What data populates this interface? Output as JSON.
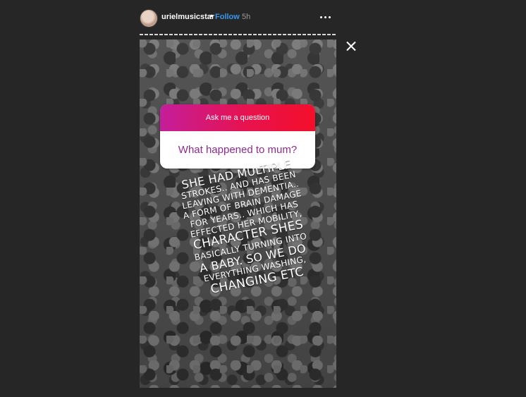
{
  "header": {
    "username": "urielmusicstar",
    "separator": "•",
    "follow_label": "Follow",
    "time": "5h"
  },
  "story": {
    "progress_segments": 1,
    "question_sticker": {
      "prompt": "Ask me a question",
      "question": "What happened to mum?"
    },
    "caption_lines": [
      "She had multiple",
      "strokes.. and has been",
      "leaving with dementia..",
      "a form of brain damage",
      "for years.. which has",
      "effected her mobility,",
      "character shes",
      "basically turning into",
      "a baby. So we do",
      "everything washing,",
      "changing etc"
    ]
  },
  "colors": {
    "background": "#262626",
    "follow": "#3897f0",
    "sticker_gradient_start": "#c41e9b",
    "sticker_gradient_end": "#f40f2a",
    "question_text": "#8f2a92"
  },
  "icons": {
    "more": "more-options-icon",
    "close": "close-icon"
  }
}
